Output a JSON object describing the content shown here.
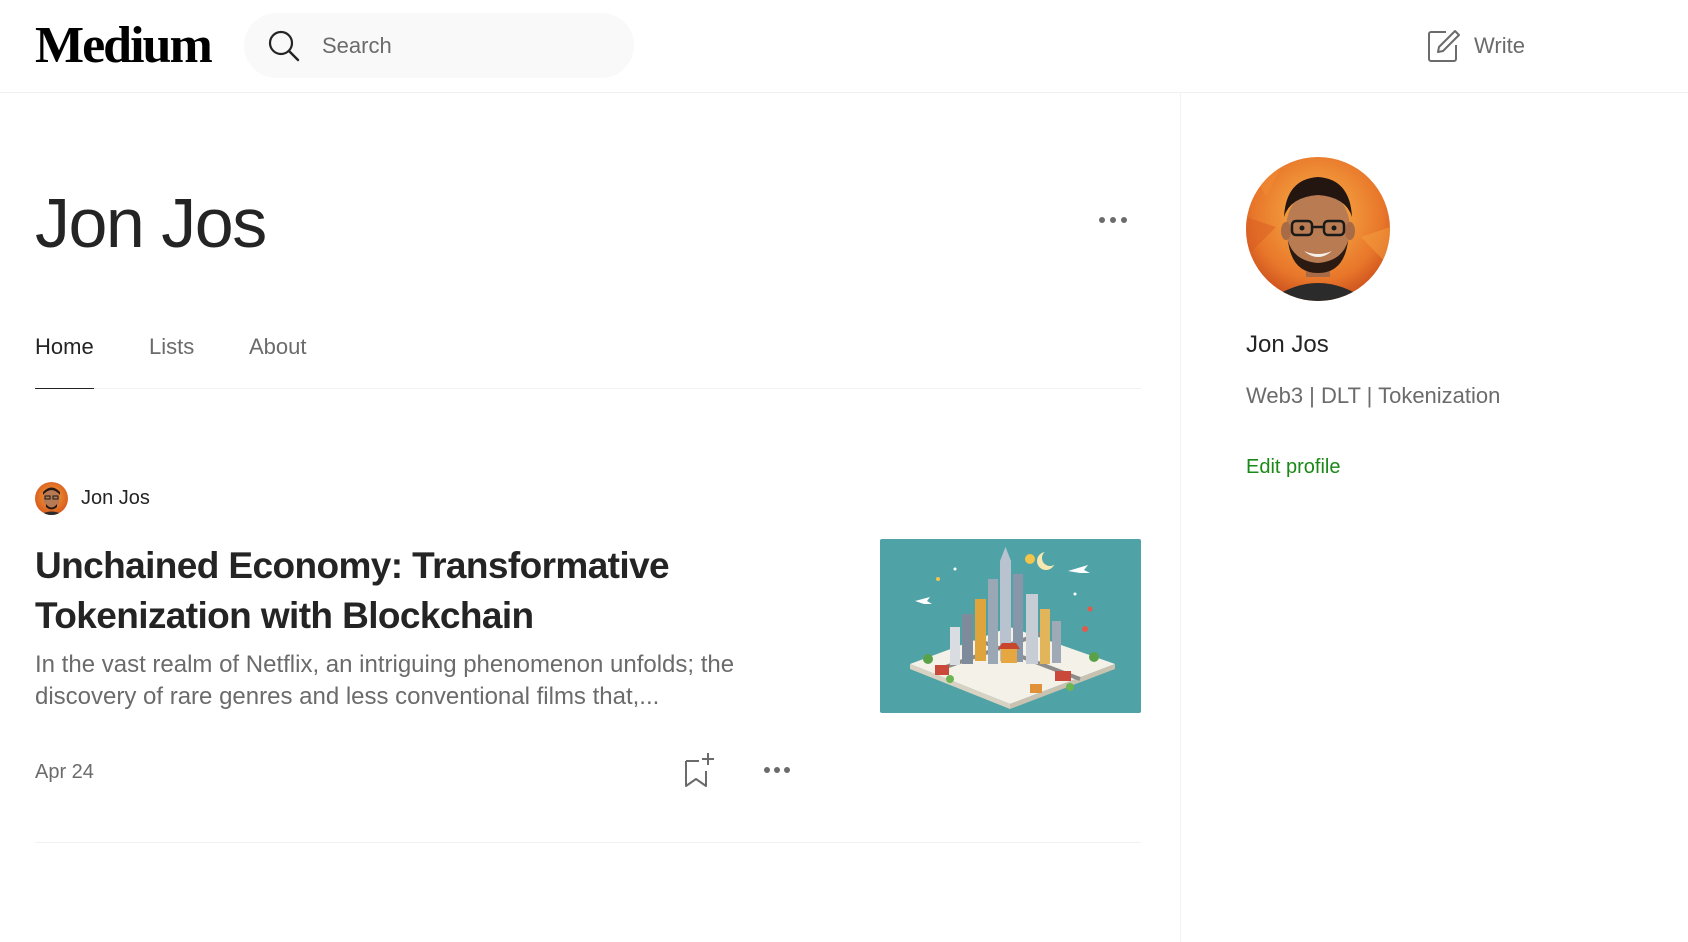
{
  "header": {
    "logo_text": "Medium",
    "search": {
      "placeholder": "Search",
      "value": "",
      "icon": "search-icon"
    },
    "write": {
      "label": "Write",
      "icon": "write-icon"
    }
  },
  "profile": {
    "name": "Jon Jos",
    "more_icon": "more-horizontal-icon",
    "tabs": [
      {
        "label": "Home",
        "active": true
      },
      {
        "label": "Lists",
        "active": false
      },
      {
        "label": "About",
        "active": false
      }
    ]
  },
  "posts": [
    {
      "author": "Jon Jos",
      "title": "Unchained Economy: Transformative Tokenization with Blockchain",
      "excerpt": "In the vast realm of Netflix, an intriguing phenomenon unfolds; the discovery of rare genres and less conventional films that,...",
      "date": "Apr 24",
      "save_icon": "bookmark-add-icon",
      "more_icon": "more-horizontal-icon",
      "thumbnail": "isometric-city-illustration"
    }
  ],
  "sidebar": {
    "name": "Jon Jos",
    "bio": "Web3 | DLT | Tokenization",
    "edit_label": "Edit profile"
  },
  "colors": {
    "text_primary": "#242424",
    "text_secondary": "#6b6b6b",
    "accent_green": "#1a8917",
    "search_bg": "#f9f9f9",
    "thumbnail_bg": "#4fa3a6"
  }
}
